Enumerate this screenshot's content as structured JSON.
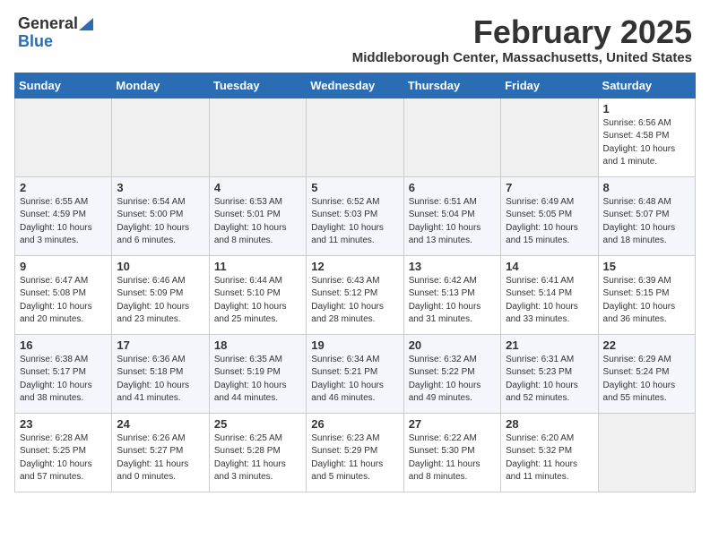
{
  "header": {
    "logo_general": "General",
    "logo_blue": "Blue",
    "month_title": "February 2025",
    "location": "Middleborough Center, Massachusetts, United States"
  },
  "days_of_week": [
    "Sunday",
    "Monday",
    "Tuesday",
    "Wednesday",
    "Thursday",
    "Friday",
    "Saturday"
  ],
  "weeks": [
    [
      {
        "day": "",
        "info": ""
      },
      {
        "day": "",
        "info": ""
      },
      {
        "day": "",
        "info": ""
      },
      {
        "day": "",
        "info": ""
      },
      {
        "day": "",
        "info": ""
      },
      {
        "day": "",
        "info": ""
      },
      {
        "day": "1",
        "info": "Sunrise: 6:56 AM\nSunset: 4:58 PM\nDaylight: 10 hours and 1 minute."
      }
    ],
    [
      {
        "day": "2",
        "info": "Sunrise: 6:55 AM\nSunset: 4:59 PM\nDaylight: 10 hours and 3 minutes."
      },
      {
        "day": "3",
        "info": "Sunrise: 6:54 AM\nSunset: 5:00 PM\nDaylight: 10 hours and 6 minutes."
      },
      {
        "day": "4",
        "info": "Sunrise: 6:53 AM\nSunset: 5:01 PM\nDaylight: 10 hours and 8 minutes."
      },
      {
        "day": "5",
        "info": "Sunrise: 6:52 AM\nSunset: 5:03 PM\nDaylight: 10 hours and 11 minutes."
      },
      {
        "day": "6",
        "info": "Sunrise: 6:51 AM\nSunset: 5:04 PM\nDaylight: 10 hours and 13 minutes."
      },
      {
        "day": "7",
        "info": "Sunrise: 6:49 AM\nSunset: 5:05 PM\nDaylight: 10 hours and 15 minutes."
      },
      {
        "day": "8",
        "info": "Sunrise: 6:48 AM\nSunset: 5:07 PM\nDaylight: 10 hours and 18 minutes."
      }
    ],
    [
      {
        "day": "9",
        "info": "Sunrise: 6:47 AM\nSunset: 5:08 PM\nDaylight: 10 hours and 20 minutes."
      },
      {
        "day": "10",
        "info": "Sunrise: 6:46 AM\nSunset: 5:09 PM\nDaylight: 10 hours and 23 minutes."
      },
      {
        "day": "11",
        "info": "Sunrise: 6:44 AM\nSunset: 5:10 PM\nDaylight: 10 hours and 25 minutes."
      },
      {
        "day": "12",
        "info": "Sunrise: 6:43 AM\nSunset: 5:12 PM\nDaylight: 10 hours and 28 minutes."
      },
      {
        "day": "13",
        "info": "Sunrise: 6:42 AM\nSunset: 5:13 PM\nDaylight: 10 hours and 31 minutes."
      },
      {
        "day": "14",
        "info": "Sunrise: 6:41 AM\nSunset: 5:14 PM\nDaylight: 10 hours and 33 minutes."
      },
      {
        "day": "15",
        "info": "Sunrise: 6:39 AM\nSunset: 5:15 PM\nDaylight: 10 hours and 36 minutes."
      }
    ],
    [
      {
        "day": "16",
        "info": "Sunrise: 6:38 AM\nSunset: 5:17 PM\nDaylight: 10 hours and 38 minutes."
      },
      {
        "day": "17",
        "info": "Sunrise: 6:36 AM\nSunset: 5:18 PM\nDaylight: 10 hours and 41 minutes."
      },
      {
        "day": "18",
        "info": "Sunrise: 6:35 AM\nSunset: 5:19 PM\nDaylight: 10 hours and 44 minutes."
      },
      {
        "day": "19",
        "info": "Sunrise: 6:34 AM\nSunset: 5:21 PM\nDaylight: 10 hours and 46 minutes."
      },
      {
        "day": "20",
        "info": "Sunrise: 6:32 AM\nSunset: 5:22 PM\nDaylight: 10 hours and 49 minutes."
      },
      {
        "day": "21",
        "info": "Sunrise: 6:31 AM\nSunset: 5:23 PM\nDaylight: 10 hours and 52 minutes."
      },
      {
        "day": "22",
        "info": "Sunrise: 6:29 AM\nSunset: 5:24 PM\nDaylight: 10 hours and 55 minutes."
      }
    ],
    [
      {
        "day": "23",
        "info": "Sunrise: 6:28 AM\nSunset: 5:25 PM\nDaylight: 10 hours and 57 minutes."
      },
      {
        "day": "24",
        "info": "Sunrise: 6:26 AM\nSunset: 5:27 PM\nDaylight: 11 hours and 0 minutes."
      },
      {
        "day": "25",
        "info": "Sunrise: 6:25 AM\nSunset: 5:28 PM\nDaylight: 11 hours and 3 minutes."
      },
      {
        "day": "26",
        "info": "Sunrise: 6:23 AM\nSunset: 5:29 PM\nDaylight: 11 hours and 5 minutes."
      },
      {
        "day": "27",
        "info": "Sunrise: 6:22 AM\nSunset: 5:30 PM\nDaylight: 11 hours and 8 minutes."
      },
      {
        "day": "28",
        "info": "Sunrise: 6:20 AM\nSunset: 5:32 PM\nDaylight: 11 hours and 11 minutes."
      },
      {
        "day": "",
        "info": ""
      }
    ]
  ]
}
